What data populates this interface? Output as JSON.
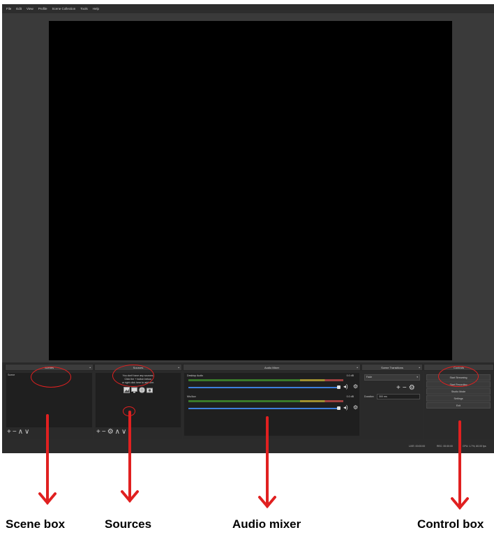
{
  "menu": [
    "File",
    "Edit",
    "View",
    "Profile",
    "Scene Collection",
    "Tools",
    "Help"
  ],
  "panels": {
    "scenes": {
      "title": "Scenes",
      "item": "Scene"
    },
    "sources": {
      "title": "Sources",
      "empty_line1": "You don't have any sources.",
      "empty_line2": "Click the + button below,",
      "empty_line3": "or right click here to add one."
    },
    "mixer": {
      "title": "Audio Mixer",
      "channel1": "Desktop Audio",
      "channel1_db": "0.0 dB",
      "channel2": "Mic/Aux",
      "channel2_db": "0.0 dB"
    },
    "transitions": {
      "title": "Scene Transitions",
      "selected": "Fade",
      "duration_label": "Duration",
      "duration_value": "300 ms"
    },
    "controls": {
      "title": "Controls",
      "buttons": [
        "Start Streaming",
        "Start Recording",
        "Studio Mode",
        "Settings",
        "Exit"
      ]
    }
  },
  "status": {
    "live": "LIVE: 00:00:00",
    "rec": "REC: 00:00:00",
    "cpu": "CPU: 1.7%, 60.00 fps"
  },
  "annotations": {
    "scene_box": "Scene box",
    "sources": "Sources",
    "audio_mixer": "Audio mixer",
    "control_box": "Control box"
  },
  "colors": {
    "annotation": "#e02020",
    "meter_green": "#3a7a2a",
    "volume_blue": "#3d7fdc"
  },
  "icons": [
    "plus-icon",
    "minus-icon",
    "gear-icon",
    "up-arrow-icon",
    "down-arrow-icon",
    "speaker-icon",
    "image-icon",
    "globe-icon",
    "camera-icon"
  ]
}
